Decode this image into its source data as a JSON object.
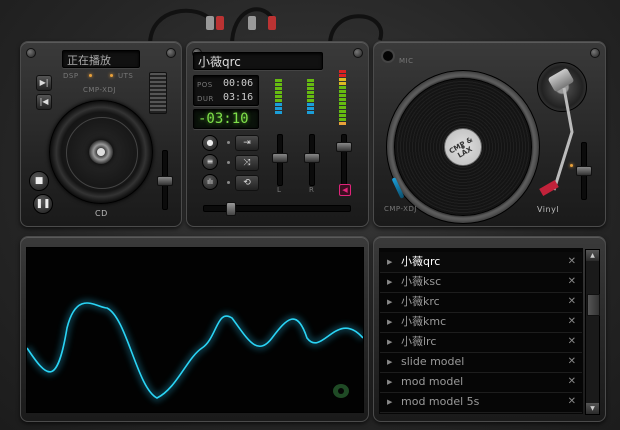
{
  "deck_left": {
    "status_text": "正在播放",
    "label_dsp": "DSP",
    "label_uts": "UTS",
    "model": "CMP-XDJ",
    "label_cd": "CD"
  },
  "mixer": {
    "track_title": "小薇qrc",
    "pos_label": "POS",
    "pos_time": "00:06",
    "dur_label": "DUR",
    "dur_time": "03:16",
    "remaining": "-03:10",
    "channel_l": "L",
    "channel_r": "R"
  },
  "turntable": {
    "mic_label": "MIC",
    "record_label": "CMP & LAX",
    "model": "CMP-XDJ",
    "vinyl_label": "Vinyl"
  },
  "playlist": {
    "items": [
      {
        "name": "小薇qrc",
        "selected": true
      },
      {
        "name": "小薇ksc",
        "selected": false
      },
      {
        "name": "小薇krc",
        "selected": false
      },
      {
        "name": "小薇kmc",
        "selected": false
      },
      {
        "name": "小薇lrc",
        "selected": false
      },
      {
        "name": "slide model",
        "selected": false
      },
      {
        "name": "mod model",
        "selected": false
      },
      {
        "name": "mod model 5s",
        "selected": false
      }
    ],
    "remove_glyph": "✕",
    "play_glyph": "▶"
  },
  "colors": {
    "lcd_green": "#7fe04a",
    "wave_cyan": "#2ad4f5",
    "led_amber": "#e8a13a",
    "accent_pink": "#e0247a"
  }
}
